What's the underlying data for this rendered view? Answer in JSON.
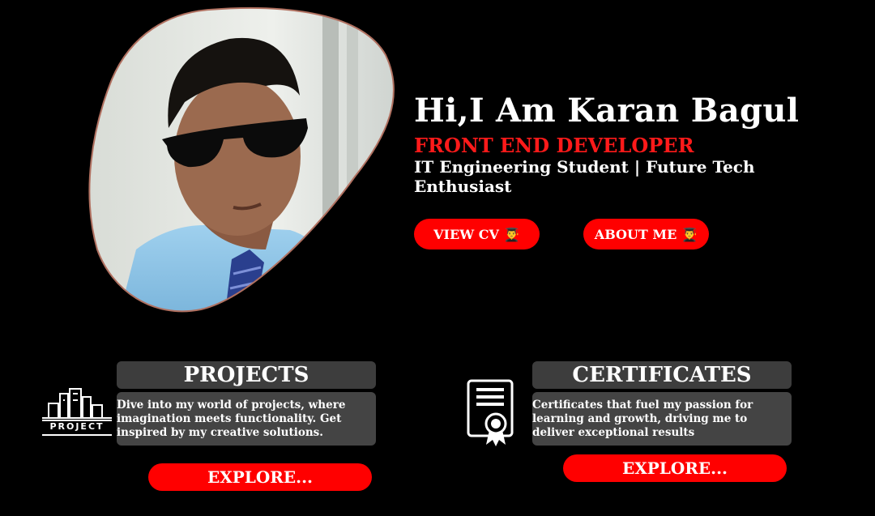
{
  "hero": {
    "title": "Hi,I Am Karan Bagul",
    "role": "FRONT END DEVELOPER",
    "subtitle": "IT Engineering Student | Future Tech Enthusiast"
  },
  "buttons": {
    "view_cv": "VIEW CV",
    "about_me": "ABOUT ME",
    "emoji": "👨‍🎓"
  },
  "projects": {
    "icon_label": "PROJECT",
    "heading": "PROJECTS",
    "description": "Dive into my world of projects, where imagination meets functionality. Get inspired by my creative solutions.",
    "explore": "EXPLORE..."
  },
  "certificates": {
    "heading": "CERTIFICATES",
    "description": "Certificates that fuel my passion for learning and growth, driving me to deliver exceptional results",
    "explore": "EXPLORE..."
  },
  "colors": {
    "background": "#000000",
    "accent_red": "#ff0000",
    "card_gray": "#444444"
  },
  "icons": {
    "portrait": "profile-photo",
    "project": "city-buildings-icon",
    "certificate": "certificate-award-icon"
  }
}
